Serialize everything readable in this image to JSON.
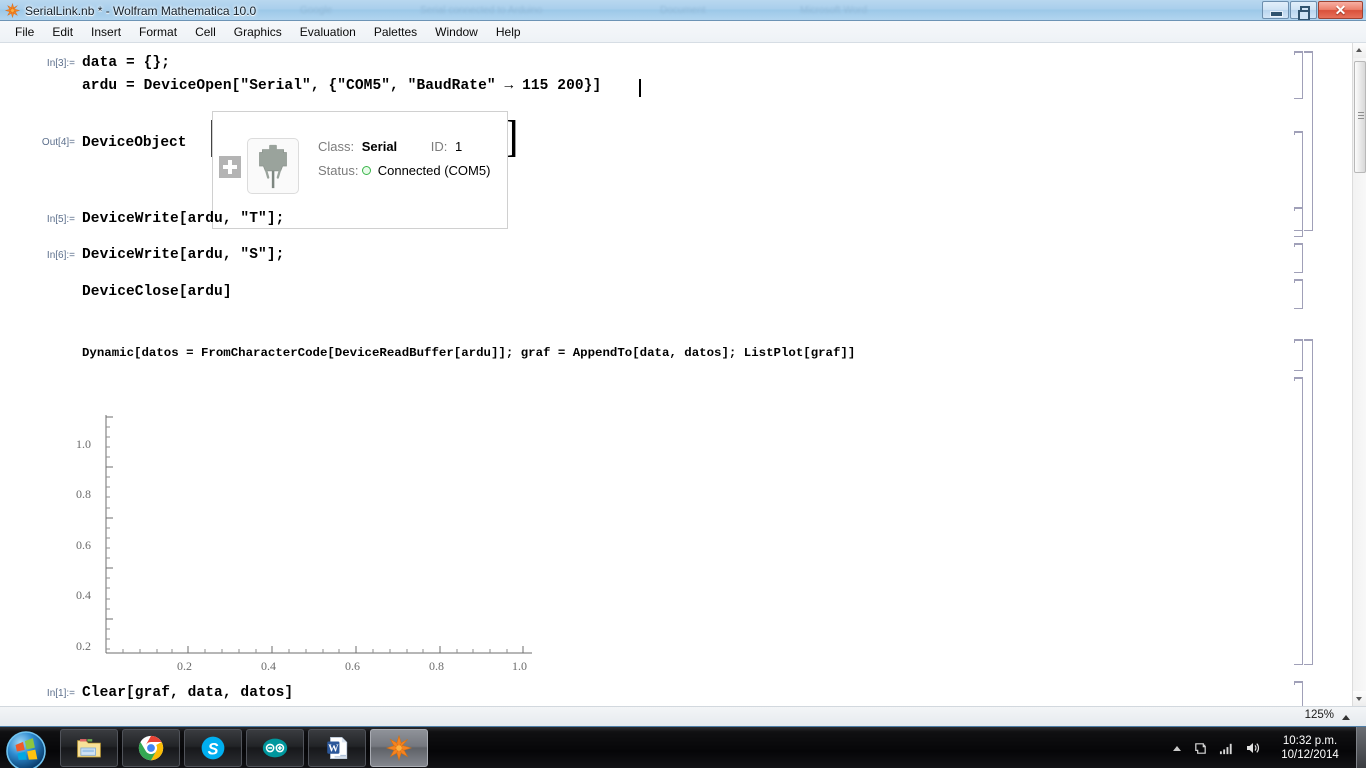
{
  "window": {
    "title": "SerialLink.nb * - Wolfram Mathematica 10.0",
    "app_icon": "mathematica-spikey-icon",
    "minimize_label": "Minimize",
    "restore_label": "Restore",
    "close_label": "✕"
  },
  "menu": {
    "items": [
      {
        "label": "File"
      },
      {
        "label": "Edit"
      },
      {
        "label": "Insert"
      },
      {
        "label": "Format"
      },
      {
        "label": "Cell"
      },
      {
        "label": "Graphics"
      },
      {
        "label": "Evaluation"
      },
      {
        "label": "Palettes"
      },
      {
        "label": "Window"
      },
      {
        "label": "Help"
      }
    ]
  },
  "notebook": {
    "cells": [
      {
        "label": "In[3]:=",
        "lines": [
          "data = {};",
          "ardu = DeviceOpen[\"Serial\", {\"COM5\", \"BaudRate\" → 115 200}]"
        ]
      },
      {
        "label": "Out[4]=",
        "head": "DeviceObject",
        "device": {
          "expand_label": "+",
          "icon": "serial-port-connector-icon",
          "class_key": "Class:",
          "class_value": "Serial",
          "id_key": "ID:",
          "id_value": "1",
          "status_key": "Status:",
          "status_value": "Connected (COM5)",
          "status_color": "#39b54a"
        }
      },
      {
        "label": "In[5]:=",
        "lines": [
          "DeviceWrite[ardu, \"T\"];"
        ]
      },
      {
        "label": "In[6]:=",
        "lines": [
          "DeviceWrite[ardu, \"S\"];"
        ]
      },
      {
        "label": "",
        "lines": [
          "DeviceClose[ardu]"
        ]
      },
      {
        "label": "",
        "lines": [
          "Dynamic[datos = FromCharacterCode[DeviceReadBuffer[ardu]]; graf = AppendTo[data, datos]; ListPlot[graf]]"
        ]
      },
      {
        "label": "In[1]:=",
        "lines": [
          "Clear[graf, data, datos]"
        ]
      }
    ]
  },
  "chart_data": {
    "type": "scatter",
    "title": "",
    "xlabel": "",
    "ylabel": "",
    "xlim": [
      0,
      1.05
    ],
    "ylim": [
      0,
      1.05
    ],
    "xticks": [
      "0.2",
      "0.4",
      "0.6",
      "0.8",
      "1.0"
    ],
    "xtick_values": [
      0.2,
      0.4,
      0.6,
      0.8,
      1.0
    ],
    "yticks": [
      "0.2",
      "0.4",
      "0.6",
      "0.8",
      "1.0"
    ],
    "ytick_values": [
      0.2,
      0.4,
      0.6,
      0.8,
      1.0
    ],
    "minor_ticks_per_interval": 4,
    "grid": false,
    "legend": null,
    "points": [],
    "note": "Empty ListPlot — axes drawn, no data points plotted"
  },
  "statusbar": {
    "zoom_level": "125%",
    "zoom_arrow": "chevron-up-icon"
  },
  "taskbar": {
    "start_label": "Start",
    "buttons": [
      {
        "name": "file-explorer",
        "label": "Windows Explorer",
        "active": false
      },
      {
        "name": "google-chrome",
        "label": "Google Chrome",
        "active": false
      },
      {
        "name": "skype",
        "label": "Skype",
        "active": false
      },
      {
        "name": "arduino-ide",
        "label": "Arduino",
        "active": false
      },
      {
        "name": "microsoft-word",
        "label": "Microsoft Word",
        "active": false
      },
      {
        "name": "mathematica",
        "label": "Wolfram Mathematica",
        "active": true
      }
    ],
    "tray": {
      "overflow": "show-hidden-icons-arrow",
      "icons": [
        "action-center-icon",
        "network-signal-icon",
        "volume-icon"
      ],
      "time": "10:32 p.m.",
      "date": "10/12/2014"
    }
  }
}
